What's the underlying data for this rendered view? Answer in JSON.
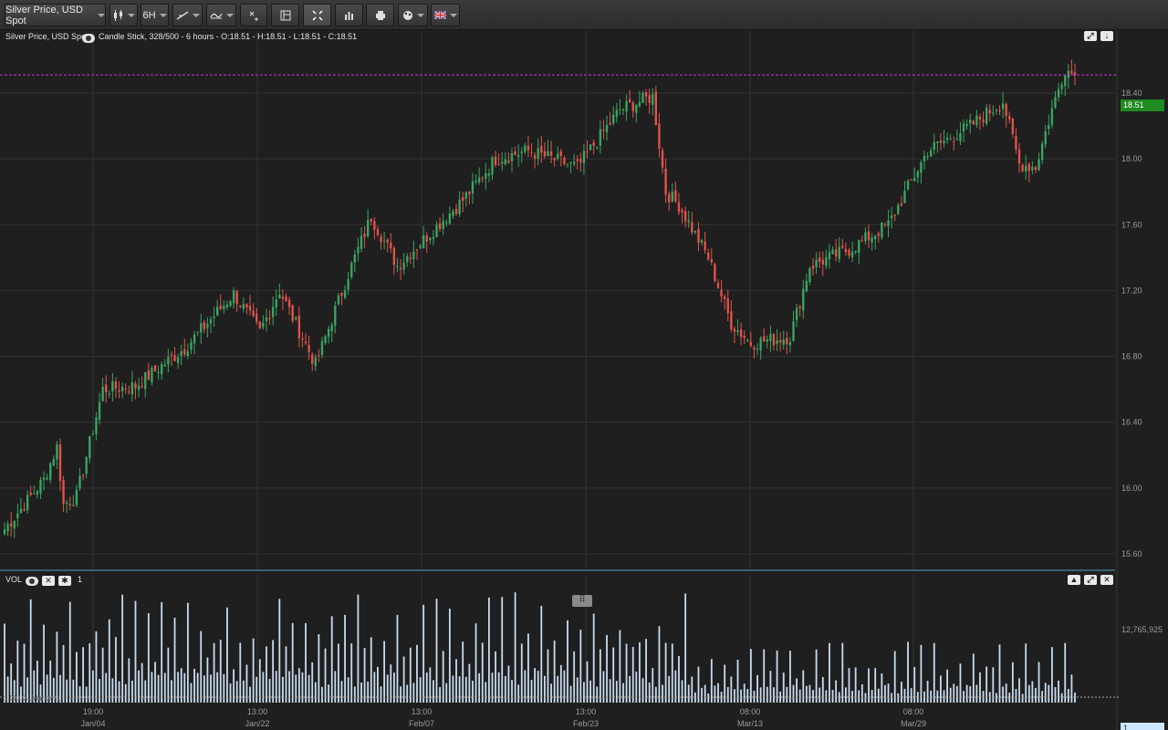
{
  "toolbar": {
    "symbol_label": "Silver Price, USD Spot",
    "interval_label": "6H",
    "icons": [
      "candlestick-icon",
      "drawing-tool-icon",
      "indicator-icon",
      "crosshair-icon",
      "layout-icon",
      "fullscreen-icon",
      "chart-type-icon",
      "print-icon",
      "theme-icon",
      "uk-flag-icon"
    ]
  },
  "header": {
    "title": "Silver Price, USD Spot",
    "info": "Candle Stick, 328/500 - 6 hours - O:18.51 - H:18.51 - L:18.51 - C:18.51"
  },
  "volume_panel": {
    "title": "VOL",
    "count": "1",
    "axis_label": "12,765,925",
    "current_value": "1",
    "watermark": "1.0k1.31Marker-1"
  },
  "price_badge": "18.51",
  "colors": {
    "up": "#3aa662",
    "down": "#e5534b",
    "volume": "#c8dcf0",
    "current_price_line": "#c03ad0",
    "background": "#1f1f1f",
    "grid": "#333333"
  },
  "chart_data": {
    "type": "candlestick",
    "price_ylim": [
      15.4,
      18.9
    ],
    "y_ticks": [
      "18.40",
      "18.00",
      "17.60",
      "17.20",
      "16.80",
      "16.40",
      "16.00",
      "15.60"
    ],
    "x_time_ticks": [
      "19:00",
      "13:00",
      "13:00",
      "13:00",
      "08:00",
      "08:00"
    ],
    "x_date_ticks": [
      "Jan/04",
      "Jan/22",
      "Feb/07",
      "Feb/23",
      "Mar/13",
      "Mar/29"
    ],
    "current_price": 18.51,
    "bar_count": 328,
    "close_keypoints": [
      {
        "i": 0,
        "c": 15.75
      },
      {
        "i": 12,
        "c": 16.05
      },
      {
        "i": 16,
        "c": 16.25
      },
      {
        "i": 18,
        "c": 15.9
      },
      {
        "i": 22,
        "c": 15.95
      },
      {
        "i": 30,
        "c": 16.6
      },
      {
        "i": 40,
        "c": 16.62
      },
      {
        "i": 55,
        "c": 16.85
      },
      {
        "i": 70,
        "c": 17.18
      },
      {
        "i": 78,
        "c": 16.95
      },
      {
        "i": 84,
        "c": 17.2
      },
      {
        "i": 95,
        "c": 16.75
      },
      {
        "i": 105,
        "c": 17.3
      },
      {
        "i": 112,
        "c": 17.65
      },
      {
        "i": 120,
        "c": 17.35
      },
      {
        "i": 140,
        "c": 17.75
      },
      {
        "i": 150,
        "c": 18.0
      },
      {
        "i": 160,
        "c": 18.05
      },
      {
        "i": 175,
        "c": 17.95
      },
      {
        "i": 188,
        "c": 18.3
      },
      {
        "i": 198,
        "c": 18.38
      },
      {
        "i": 202,
        "c": 17.8
      },
      {
        "i": 206,
        "c": 17.72
      },
      {
        "i": 215,
        "c": 17.4
      },
      {
        "i": 222,
        "c": 17.0
      },
      {
        "i": 228,
        "c": 16.88
      },
      {
        "i": 240,
        "c": 16.92
      },
      {
        "i": 246,
        "c": 17.35
      },
      {
        "i": 258,
        "c": 17.45
      },
      {
        "i": 270,
        "c": 17.6
      },
      {
        "i": 282,
        "c": 18.05
      },
      {
        "i": 295,
        "c": 18.2
      },
      {
        "i": 305,
        "c": 18.35
      },
      {
        "i": 310,
        "c": 17.97
      },
      {
        "i": 315,
        "c": 17.95
      },
      {
        "i": 320,
        "c": 18.3
      },
      {
        "i": 324,
        "c": 18.55
      },
      {
        "i": 327,
        "c": 18.51
      }
    ],
    "volume_ylim": [
      0,
      14800000
    ]
  }
}
